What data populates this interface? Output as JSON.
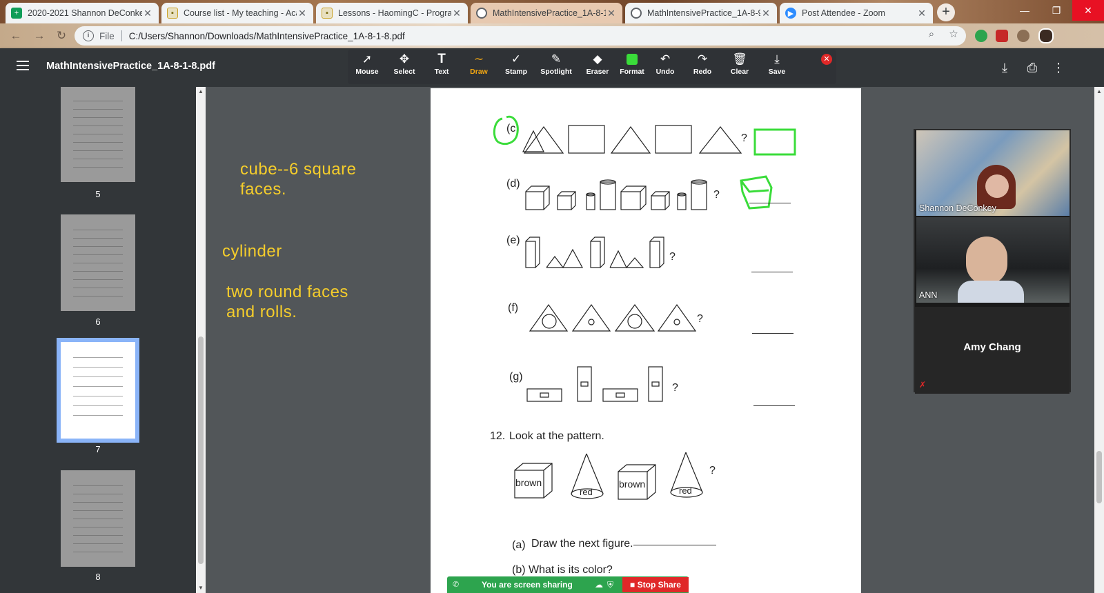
{
  "browser": {
    "tabs": [
      {
        "title": "2020-2021 Shannon DeConkey",
        "icon": "sheets-icon",
        "color": "#0f9d58"
      },
      {
        "title": "Course list - My teaching - Aca",
        "icon": "document-icon",
        "color": "#c9a227"
      },
      {
        "title": "Lessons - HaomingC - Program",
        "icon": "document-icon",
        "color": "#c9a227"
      },
      {
        "title": "MathIntensivePractice_1A-8-1",
        "icon": "globe-icon",
        "color": "#5f6368"
      },
      {
        "title": "MathIntensivePractice_1A-8-9-",
        "icon": "globe-icon",
        "color": "#5f6368"
      },
      {
        "title": "Post Attendee - Zoom",
        "icon": "zoom-icon",
        "color": "#2d8cff"
      }
    ],
    "new_tab": "+",
    "address": {
      "scheme_label": "File",
      "url": "C:/Users/Shannon/Downloads/MathIntensivePractice_1A-8-1-8.pdf"
    }
  },
  "pdf_viewer": {
    "title": "MathIntensivePractice_1A-8-1-8.pdf",
    "thumbnails": [
      {
        "page": "5"
      },
      {
        "page": "6"
      },
      {
        "page": "7",
        "selected": true
      },
      {
        "page": "8"
      }
    ]
  },
  "annotation_toolbar": {
    "tools": [
      {
        "label": "Mouse",
        "icon": "cursor-icon"
      },
      {
        "label": "Select",
        "icon": "move-icon"
      },
      {
        "label": "Text",
        "icon": "text-icon"
      },
      {
        "label": "Draw",
        "icon": "draw-icon",
        "active": true
      },
      {
        "label": "Stamp",
        "icon": "check-icon"
      },
      {
        "label": "Spotlight",
        "icon": "spotlight-icon"
      },
      {
        "label": "Eraser",
        "icon": "eraser-icon"
      },
      {
        "label": "Format",
        "icon": "format-icon",
        "color": "#3adc3a"
      },
      {
        "label": "Undo",
        "icon": "undo-icon"
      },
      {
        "label": "Redo",
        "icon": "redo-icon"
      },
      {
        "label": "Clear",
        "icon": "trash-icon"
      },
      {
        "label": "Save",
        "icon": "save-icon"
      }
    ]
  },
  "notes": {
    "cube_line1": "cube--6 square",
    "cube_line2": "faces.",
    "cylinder": "cylinder",
    "round_line1": "two round faces",
    "round_line2": "and rolls.",
    "color": "#f5cd2b"
  },
  "worksheet": {
    "items": [
      {
        "label": "(c"
      },
      {
        "label": "(d)"
      },
      {
        "label": "(e)"
      },
      {
        "label": "(f)"
      },
      {
        "label": "(g)"
      }
    ],
    "qmark": "?",
    "question12": {
      "number": "12.",
      "text": "Look at the pattern."
    },
    "pattern_labels": {
      "brown1": "brown",
      "red1": "red",
      "brown2": "brown",
      "red2": "red"
    },
    "sub_a": {
      "label": "(a)",
      "text": "Draw the next figure."
    },
    "sub_b_partial": "(b)   What is its color?"
  },
  "zoom": {
    "participants": [
      {
        "name": "Shannon DeConkey"
      },
      {
        "name": "ANN"
      },
      {
        "name": "Amy Chang",
        "muted": true
      }
    ],
    "share_bar": {
      "status": "You are screen sharing",
      "stop": "Stop Share"
    }
  }
}
